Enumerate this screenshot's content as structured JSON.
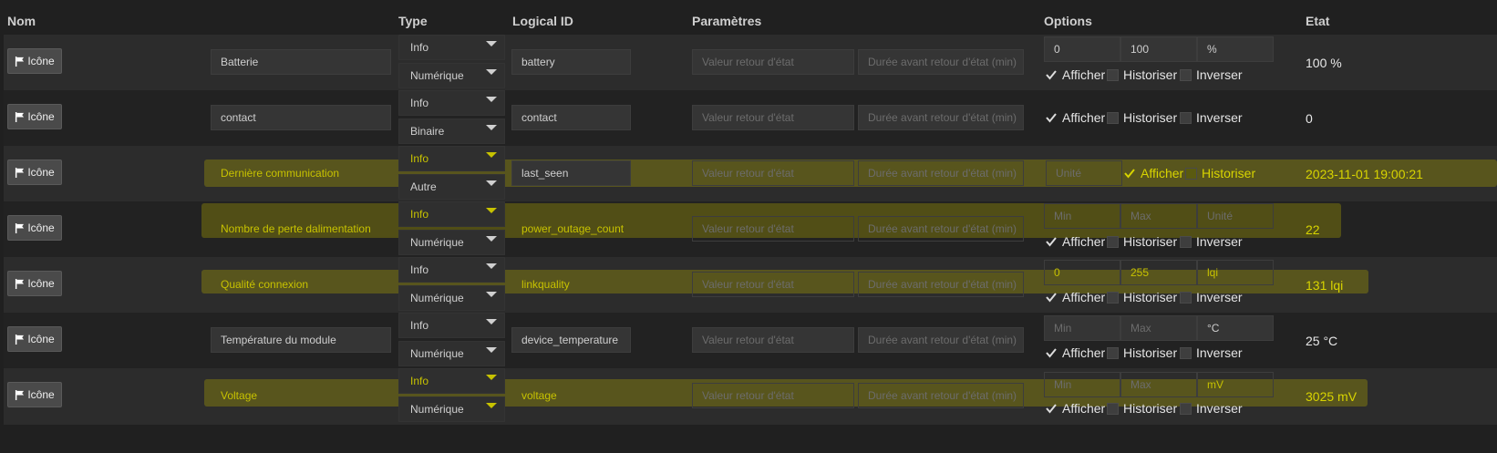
{
  "headers": {
    "nom": "Nom",
    "type": "Type",
    "logical_id": "Logical ID",
    "parametres": "Paramètres",
    "options": "Options",
    "etat": "Etat"
  },
  "icon_button_label": "Icône",
  "placeholders": {
    "valeur_retour": "Valeur retour d'état",
    "duree_retour": "Durée avant retour d'état (min)",
    "min": "Min",
    "max": "Max",
    "unite": "Unité"
  },
  "option_labels": {
    "afficher": "Afficher",
    "historiser": "Historiser",
    "inverser": "Inverser"
  },
  "rows": [
    {
      "name": "Batterie",
      "type": "Info",
      "subtype": "Numérique",
      "logical_id": "battery",
      "min": "0",
      "max": "100",
      "unit": "%",
      "afficher": true,
      "historiser": false,
      "inverser": false,
      "etat": "100 %"
    },
    {
      "name": "contact",
      "type": "Info",
      "subtype": "Binaire",
      "logical_id": "contact",
      "afficher": true,
      "historiser": false,
      "inverser": false,
      "etat": "0"
    },
    {
      "name": "Dernière communication",
      "type": "Info",
      "subtype": "Autre",
      "logical_id": "last_seen",
      "unit": "",
      "afficher": true,
      "historiser": false,
      "etat": "2023-11-01 19:00:21"
    },
    {
      "name": "Nombre de perte dalimentation",
      "type": "Info",
      "subtype": "Numérique",
      "logical_id": "power_outage_count",
      "min": "",
      "max": "",
      "unit": "",
      "afficher": true,
      "historiser": false,
      "inverser": false,
      "etat": "22"
    },
    {
      "name": "Qualité connexion",
      "type": "Info",
      "subtype": "Numérique",
      "logical_id": "linkquality",
      "min": "0",
      "max": "255",
      "unit": "lqi",
      "afficher": true,
      "historiser": false,
      "inverser": false,
      "etat": "131 lqi"
    },
    {
      "name": "Température du module",
      "type": "Info",
      "subtype": "Numérique",
      "logical_id": "device_temperature",
      "min": "",
      "max": "",
      "unit": "°C",
      "afficher": true,
      "historiser": false,
      "inverser": false,
      "etat": "25 °C"
    },
    {
      "name": "Voltage",
      "type": "Info",
      "subtype": "Numérique",
      "logical_id": "voltage",
      "min": "",
      "max": "",
      "unit": "mV",
      "afficher": true,
      "historiser": false,
      "inverser": false,
      "etat": "3025 mV"
    }
  ],
  "colors": {
    "highlight": "#b4aa00",
    "highlight_text": "#c7c200",
    "background": "#202020"
  }
}
